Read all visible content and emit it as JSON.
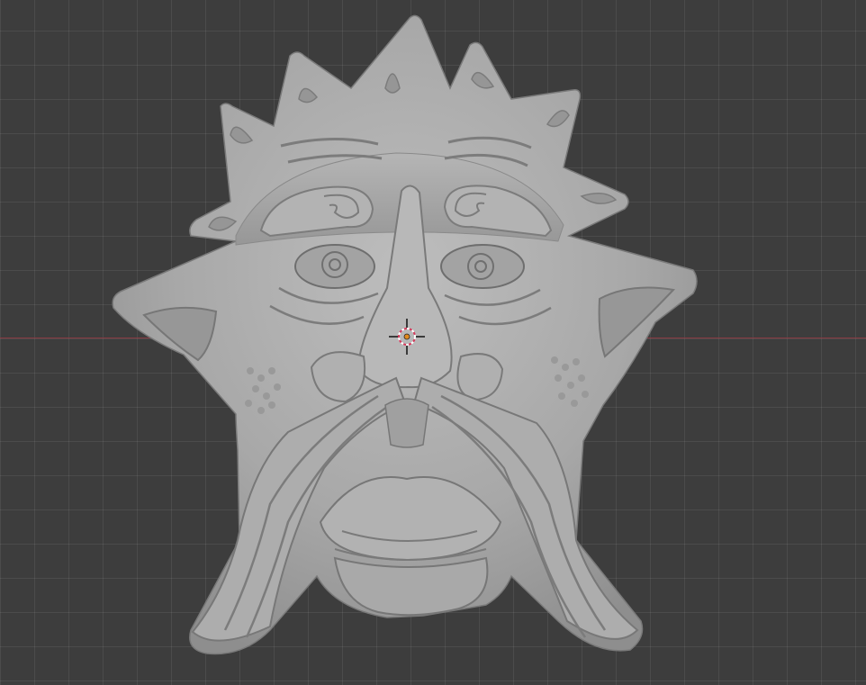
{
  "viewport": {
    "background": "#3d3d3d",
    "grid": true,
    "x_axis_color": "#8a3a42"
  },
  "object": {
    "name": "sculpted-face-relief",
    "material_color": "#a6a6a6"
  },
  "cursor": {
    "icon": "3d-cursor-icon",
    "origin_color": "#e08a1e",
    "ring_colors": [
      "#d63a5c",
      "#ffffff"
    ]
  }
}
